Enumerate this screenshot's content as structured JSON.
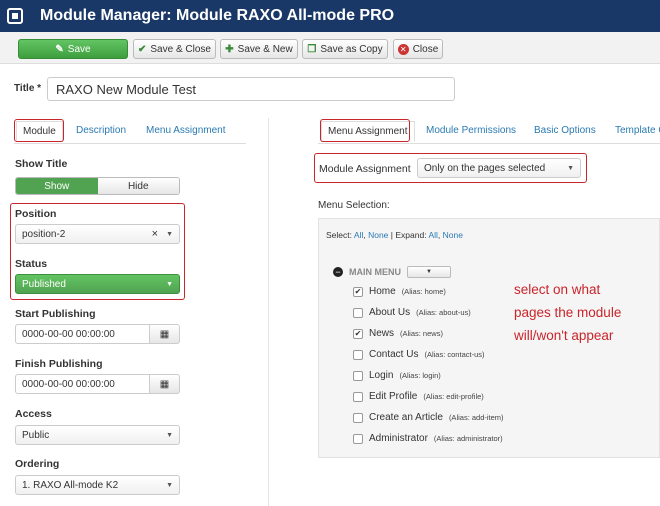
{
  "header": {
    "title": "Module Manager: Module RAXO All-mode PRO",
    "logo_icon": "joomla-logo-icon"
  },
  "toolbar": {
    "save": "Save",
    "save_close": "Save & Close",
    "save_new": "Save & New",
    "save_copy": "Save as Copy",
    "close": "Close"
  },
  "title_field": {
    "label": "Title *",
    "value": "RAXO New Module Test"
  },
  "left_tabs": [
    "Module",
    "Description",
    "Menu Assignment"
  ],
  "right_tabs": [
    "Menu Assignment",
    "Module Permissions",
    "Basic Options",
    "Template O"
  ],
  "show_title": {
    "label": "Show Title",
    "on": "Show",
    "off": "Hide"
  },
  "position": {
    "label": "Position",
    "value": "position-2",
    "clear": "×"
  },
  "status": {
    "label": "Status",
    "value": "Published"
  },
  "start_publishing": {
    "label": "Start Publishing",
    "value": "0000-00-00 00:00:00"
  },
  "finish_publishing": {
    "label": "Finish Publishing",
    "value": "0000-00-00 00:00:00"
  },
  "access": {
    "label": "Access",
    "value": "Public"
  },
  "ordering": {
    "label": "Ordering",
    "value": "1. RAXO All-mode K2"
  },
  "module_assignment": {
    "label": "Module Assignment",
    "value": "Only on the pages selected"
  },
  "menu_selection": {
    "label": "Menu Selection:",
    "select_label": "Select:",
    "all": "All",
    "none": "None",
    "expand_label": "Expand:",
    "expand_all": "All",
    "expand_none": "None",
    "menu_name": "MAIN MENU",
    "items": [
      {
        "name": "Home",
        "alias": "(Alias: home)",
        "checked": true
      },
      {
        "name": "About Us",
        "alias": "(Alias: about-us)",
        "checked": false
      },
      {
        "name": "News",
        "alias": "(Alias: news)",
        "checked": true
      },
      {
        "name": "Contact Us",
        "alias": "(Alias: contact-us)",
        "checked": false
      },
      {
        "name": "Login",
        "alias": "(Alias: login)",
        "checked": false
      },
      {
        "name": "Edit Profile",
        "alias": "(Alias: edit-profile)",
        "checked": false
      },
      {
        "name": "Create an Article",
        "alias": "(Alias: add-item)",
        "checked": false
      },
      {
        "name": "Administrator",
        "alias": "(Alias: administrator)",
        "checked": false
      }
    ]
  },
  "annotation": [
    "select on what",
    "pages the module",
    "will/won't appear"
  ],
  "colors": {
    "header": "#1a3867",
    "accent_green": "#51a351",
    "annotation_red": "#c9252b",
    "link": "#2a7ab3"
  }
}
